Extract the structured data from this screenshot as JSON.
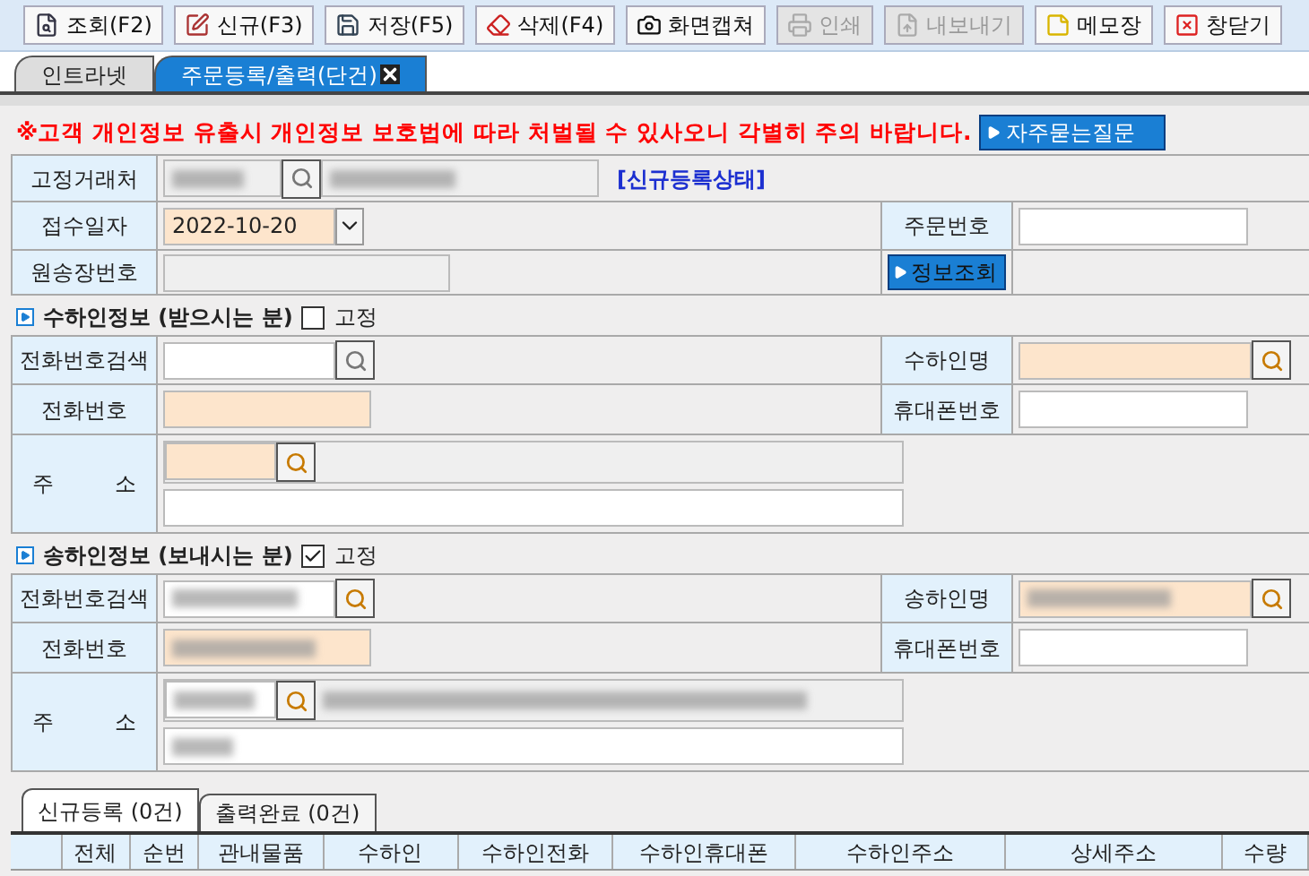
{
  "toolbar": [
    {
      "label": "조회(F2)",
      "kind": "search",
      "disabled": false
    },
    {
      "label": "신규(F3)",
      "kind": "edit",
      "disabled": false
    },
    {
      "label": "저장(F5)",
      "kind": "save",
      "disabled": false
    },
    {
      "label": "삭제(F4)",
      "kind": "delete",
      "disabled": false
    },
    {
      "label": "화면캡쳐",
      "kind": "capture",
      "disabled": false
    },
    {
      "label": "인쇄",
      "kind": "print",
      "disabled": true
    },
    {
      "label": "내보내기",
      "kind": "export",
      "disabled": true
    },
    {
      "label": "메모장",
      "kind": "memo",
      "disabled": false
    },
    {
      "label": "창닫기",
      "kind": "close",
      "disabled": false
    }
  ],
  "tabs": [
    {
      "label": "인트라넷",
      "selected": false,
      "closable": false
    },
    {
      "label": "주문등록/출력(단건)",
      "selected": true,
      "closable": true
    }
  ],
  "notice": "※고객 개인정보 유출시 개인정보 보호법에 따라 처벌될 수 있사오니 각별히 주의 바랍니다.",
  "faq_button": "자주묻는질문",
  "order": {
    "client": {
      "label": "고정거래처",
      "redacted": true
    },
    "status": "[신규등록상태]",
    "received_date": {
      "label": "접수일자",
      "value": "2022-10-20"
    },
    "order_no": {
      "label": "주문번호"
    },
    "original_invoice": {
      "label": "원송장번호"
    },
    "lookup_button": "정보조회"
  },
  "parties": [
    {
      "title": "수하인정보 (받으시는 분)",
      "fixed_label": "고정",
      "fixed": false,
      "redacted": false,
      "phone_search_label": "전화번호검색",
      "name_label": "수하인명",
      "phone_label": "전화번호",
      "mobile_label": "휴대폰번호",
      "address_label": "주 소"
    },
    {
      "title": "송하인정보 (보내시는 분)",
      "fixed_label": "고정",
      "fixed": true,
      "redacted": true,
      "phone_search_label": "전화번호검색",
      "name_label": "송하인명",
      "phone_label": "전화번호",
      "mobile_label": "휴대폰번호",
      "address_label": "주 소"
    }
  ],
  "list_tabs": [
    {
      "label": "신규등록 (0건)",
      "selected": true
    },
    {
      "label": "출력완료 (0건)",
      "selected": false
    }
  ],
  "table": {
    "columns": [
      "전체",
      "순번",
      "관내물품",
      "수하인",
      "수하인전화",
      "수하인휴대폰",
      "수하인주소",
      "상세주소",
      "수량"
    ]
  }
}
